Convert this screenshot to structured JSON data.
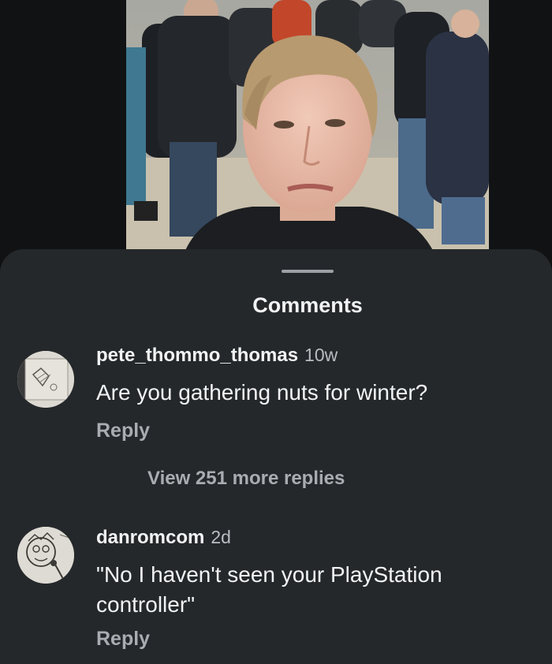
{
  "comments_sheet": {
    "title": "Comments",
    "comments": [
      {
        "username": "pete_thommo_thomas",
        "time": "10w",
        "text": "Are you gathering nuts for winter?",
        "reply_label": "Reply",
        "view_replies_label": "View 251 more replies"
      },
      {
        "username": "danromcom",
        "time": "2d",
        "text": "\"No I haven't seen your PlayStation controller\"",
        "reply_label": "Reply"
      }
    ]
  },
  "colors": {
    "sheet_background": "#25282b",
    "primary_text": "#f2f3f4",
    "secondary_text": "#a9adb1"
  }
}
